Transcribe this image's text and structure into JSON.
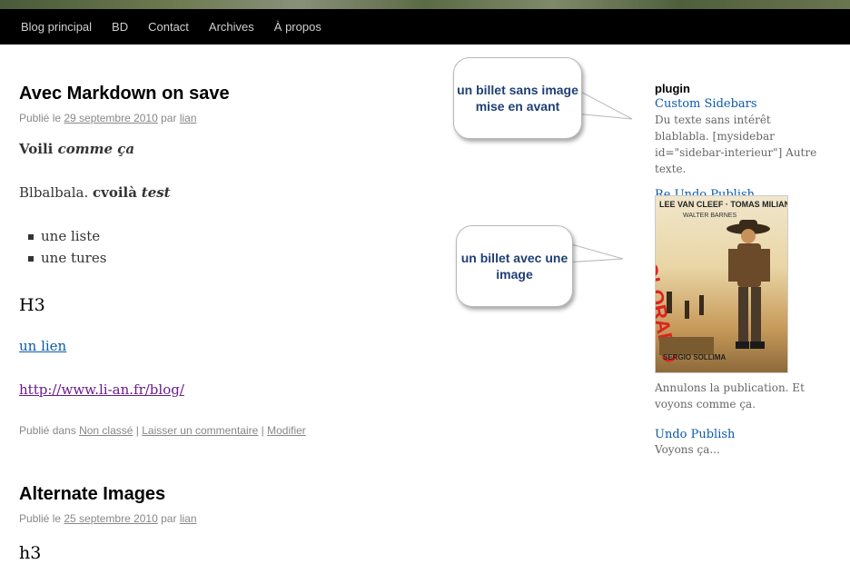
{
  "nav": {
    "items": [
      "Blog principal",
      "BD",
      "Contact",
      "Archives",
      "À propos"
    ]
  },
  "post1": {
    "title": "Avec Markdown on save",
    "meta_prefix": "Publié le",
    "date": "29 septembre 2010",
    "meta_by": "par",
    "author": "lian",
    "p1_plain": "Voili",
    "p1_em": "comme ça",
    "p2_plain": "Blbalbala.",
    "p2_bold": "cvoilà",
    "p2_em": "test",
    "list": [
      "une liste",
      "une tures"
    ],
    "h3": "H3",
    "link": "un lien",
    "url": "http://www.li-an.fr/blog/",
    "footer_prefix": "Publié dans",
    "category": "Non classé",
    "comment_link": "Laisser un commentaire",
    "edit_link": "Modifier",
    "sep": "|"
  },
  "post2": {
    "title": "Alternate Images",
    "meta_prefix": "Publié le",
    "date": "25 septembre 2010",
    "meta_by": "par",
    "author": "lian",
    "h3": "h3"
  },
  "callouts": {
    "top": "un billet sans image mise en avant",
    "bottom": "un billet avec une image"
  },
  "sidebar": {
    "widget_title": "plugin",
    "item1_title": "Custom Sidebars",
    "item1_text": "Du texte sans intérêt blablabla. [mysidebar id=\"sidebar-interieur\"] Autre texte.",
    "item2_title": "Re Undo Publish",
    "item2_text": "Annulons la publication. Et voyons comme ça.",
    "item3_title": "Undo Publish",
    "item3_text": "Voyons ça..."
  },
  "poster": {
    "top_text": "LEE VAN CLEEF · TOMAS MILIAN",
    "sub_text": "WALTER BARNES",
    "title_text": "COLORADO",
    "bottom_text": "SERGIO SOLLIMA"
  },
  "colors": {
    "link": "#0b5aa8",
    "visited": "#6a1b8a",
    "callout_text": "#1f3f73",
    "nav_bg": "#000000"
  }
}
